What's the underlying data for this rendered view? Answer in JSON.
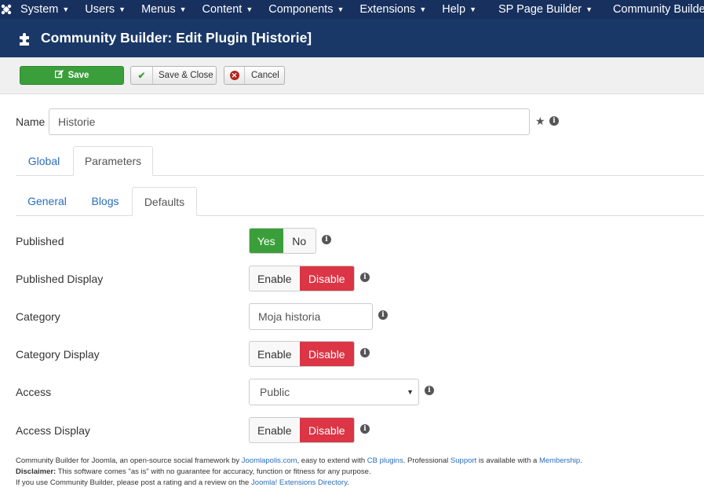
{
  "topnav": {
    "items": [
      "System",
      "Users",
      "Menus",
      "Content",
      "Components",
      "Extensions",
      "Help",
      "SP Page Builder",
      "Community Builder"
    ]
  },
  "title": "Community Builder: Edit Plugin [Historie]",
  "toolbar": {
    "save_label": "Save",
    "save_close_label": "Save & Close",
    "cancel_label": "Cancel"
  },
  "name_field": {
    "label": "Name",
    "value": "Historie"
  },
  "tabs": [
    "Global",
    "Parameters"
  ],
  "subtabs": [
    "General",
    "Blogs",
    "Defaults"
  ],
  "form": {
    "published": {
      "label": "Published",
      "yes": "Yes",
      "no": "No",
      "selected": "Yes"
    },
    "published_display": {
      "label": "Published Display",
      "enable": "Enable",
      "disable": "Disable",
      "selected": "Disable"
    },
    "category": {
      "label": "Category",
      "value": "Moja historia"
    },
    "category_display": {
      "label": "Category Display",
      "enable": "Enable",
      "disable": "Disable",
      "selected": "Disable"
    },
    "access": {
      "label": "Access",
      "value": "Public"
    },
    "access_display": {
      "label": "Access Display",
      "enable": "Enable",
      "disable": "Disable",
      "selected": "Disable"
    }
  },
  "footer": {
    "line1_a": "Community Builder for Joomla, an open-source social framework by ",
    "link_joomlapolis": "Joomlapolis.com",
    "line1_b": ", easy to extend with ",
    "link_cbplugins": "CB plugins",
    "line1_c": ". Professional ",
    "link_support": "Support",
    "line1_d": " is available with a ",
    "link_membership": "Membership",
    "line1_e": ".",
    "disclaimer_label": "Disclaimer:",
    "disclaimer_text": " This software comes \"as is\" with no guarantee for accuracy, function or fitness for any purpose.",
    "line3_a": "If you use Community Builder, please post a rating and a review on the ",
    "link_jed": "Joomla! Extensions Directory",
    "line3_b": "."
  },
  "colors": {
    "nav_bg": "#17305e",
    "title_bg": "#1a3867",
    "green": "#3a9f3a",
    "red": "#dc3545",
    "link": "#2a6ebb"
  }
}
